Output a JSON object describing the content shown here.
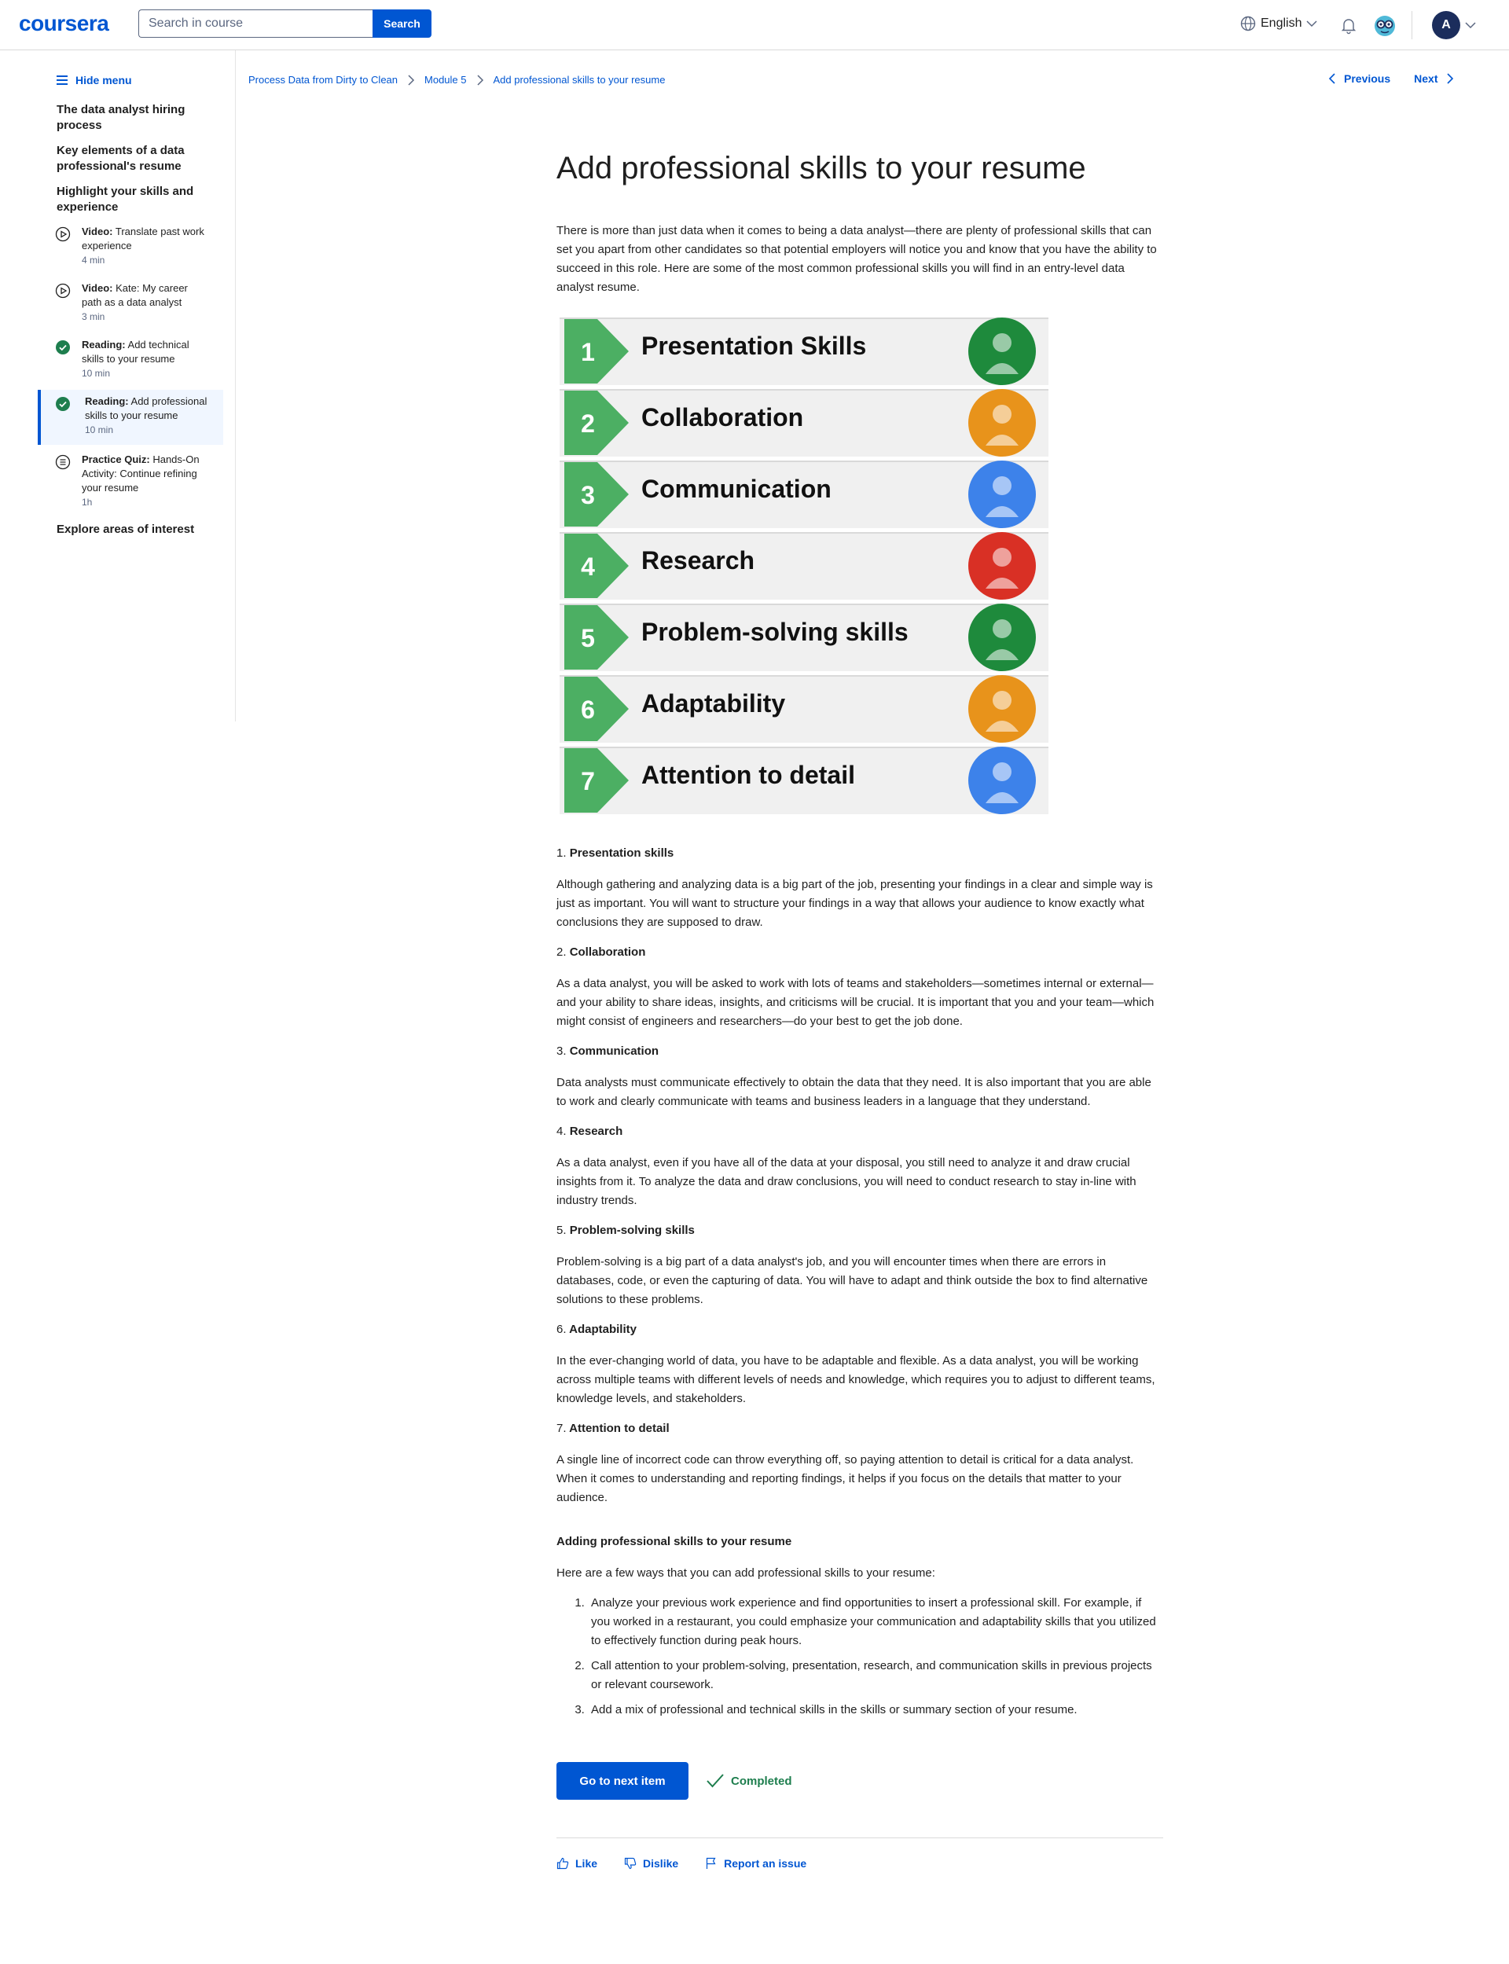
{
  "header": {
    "logo": "coursera",
    "search_placeholder": "Search in course",
    "search_button": "Search",
    "language": "English",
    "avatar_initial": "A"
  },
  "sidebar": {
    "hide_menu": "Hide menu",
    "sections": [
      "The data analyst hiring process",
      "Key elements of a data professional's resume",
      "Highlight your skills and experience",
      "Explore areas of interest"
    ],
    "items": [
      {
        "type": "Video:",
        "title": "Translate past work experience",
        "duration": "4 min",
        "icon": "play-icon"
      },
      {
        "type": "Video:",
        "title": "Kate: My career path as a data analyst",
        "duration": "3 min",
        "icon": "play-icon"
      },
      {
        "type": "Reading:",
        "title": "Add technical skills to your resume",
        "duration": "10 min",
        "icon": "check-icon"
      },
      {
        "type": "Reading:",
        "title": "Add professional skills to your resume",
        "duration": "10 min",
        "icon": "check-icon"
      },
      {
        "type": "Practice Quiz:",
        "title": "Hands-On Activity: Continue refining your resume",
        "duration": "1h",
        "icon": "quiz-icon"
      }
    ]
  },
  "breadcrumb": [
    "Process Data from Dirty to Clean",
    "Module 5",
    "Add professional skills to your resume"
  ],
  "nav": {
    "previous": "Previous",
    "next": "Next"
  },
  "content": {
    "title": "Add professional skills to your resume",
    "intro": "There is more than just data when it comes to being a data analyst—there are plenty of professional skills that can set you apart from other candidates so that potential employers will notice you and know that you have the ability to succeed in this role. Here are some of the most common professional skills you will find in an entry-level data analyst resume.",
    "infographic": [
      {
        "num": "1",
        "label": "Presentation Skills",
        "color": "#1e8a3c"
      },
      {
        "num": "2",
        "label": "Collaboration",
        "color": "#e8931b"
      },
      {
        "num": "3",
        "label": "Communication",
        "color": "#3d82ea"
      },
      {
        "num": "4",
        "label": "Research",
        "color": "#d93025"
      },
      {
        "num": "5",
        "label": "Problem-solving skills",
        "color": "#1e8a3c"
      },
      {
        "num": "6",
        "label": "Adaptability",
        "color": "#e8931b"
      },
      {
        "num": "7",
        "label": "Attention to detail",
        "color": "#3d82ea"
      }
    ],
    "skills": [
      {
        "num": "1.",
        "name": "Presentation skills",
        "text": "Although gathering and analyzing data is a big part of the job, presenting your findings in a clear and simple way is just as important. You will want to structure your findings in a way that allows your audience to know exactly what conclusions they are supposed to draw."
      },
      {
        "num": "2.",
        "name": "Collaboration",
        "text": "As a data analyst, you will be asked to work with lots of teams and stakeholders—sometimes internal or external—and your ability to share ideas, insights, and criticisms will be crucial. It is important that you and your team—which might consist of engineers and researchers—do your best to get the job done."
      },
      {
        "num": "3.",
        "name": "Communication",
        "text": "Data analysts must communicate effectively to obtain the data that they need. It is also important that you are able to work and clearly communicate with teams and business leaders in a language that they understand."
      },
      {
        "num": "4.",
        "name": "Research",
        "text": "As a data analyst, even if you have all of the data at your disposal, you still need to analyze it and draw crucial insights from it. To analyze the data and draw conclusions, you will need to conduct research to stay in-line with industry trends."
      },
      {
        "num": "5.",
        "name": "Problem-solving skills",
        "text": "Problem-solving is a big part of a data analyst's job, and you will encounter times when there are errors in databases, code, or even the capturing of data. You will have to adapt and think outside the box to find alternative solutions to these problems."
      },
      {
        "num": "6.",
        "name": "Adaptability",
        "text": "In the ever-changing world of data, you have to be adaptable and flexible. As a data analyst, you will be working across multiple teams with different levels of needs and knowledge, which requires you to adjust to different teams, knowledge levels, and stakeholders."
      },
      {
        "num": "7.",
        "name": "Attention to detail",
        "text": "A single line of incorrect code can throw everything off, so paying attention to detail is critical for a data analyst. When it comes to understanding and reporting findings, it helps if you focus on the details that matter to your audience."
      }
    ],
    "adding_heading": "Adding professional skills to your resume",
    "adding_intro": "Here are a few ways that you can add professional skills to your resume:",
    "tips": [
      "Analyze your previous work experience and find opportunities to insert a professional skill. For example, if you worked in a restaurant, you could emphasize your communication and adaptability skills that you utilized to effectively function during peak hours.",
      "Call attention to your problem-solving, presentation, research, and communication skills in previous projects or relevant coursework.",
      "Add a mix of professional and technical skills in the skills or summary section of your resume."
    ]
  },
  "actions": {
    "next_item": "Go to next item",
    "completed": "Completed"
  },
  "feedback": {
    "like": "Like",
    "dislike": "Dislike",
    "report": "Report an issue"
  },
  "colors": {
    "brand": "#0056d2",
    "success": "#1e7e4e",
    "arrow_green": "#4caf63"
  }
}
